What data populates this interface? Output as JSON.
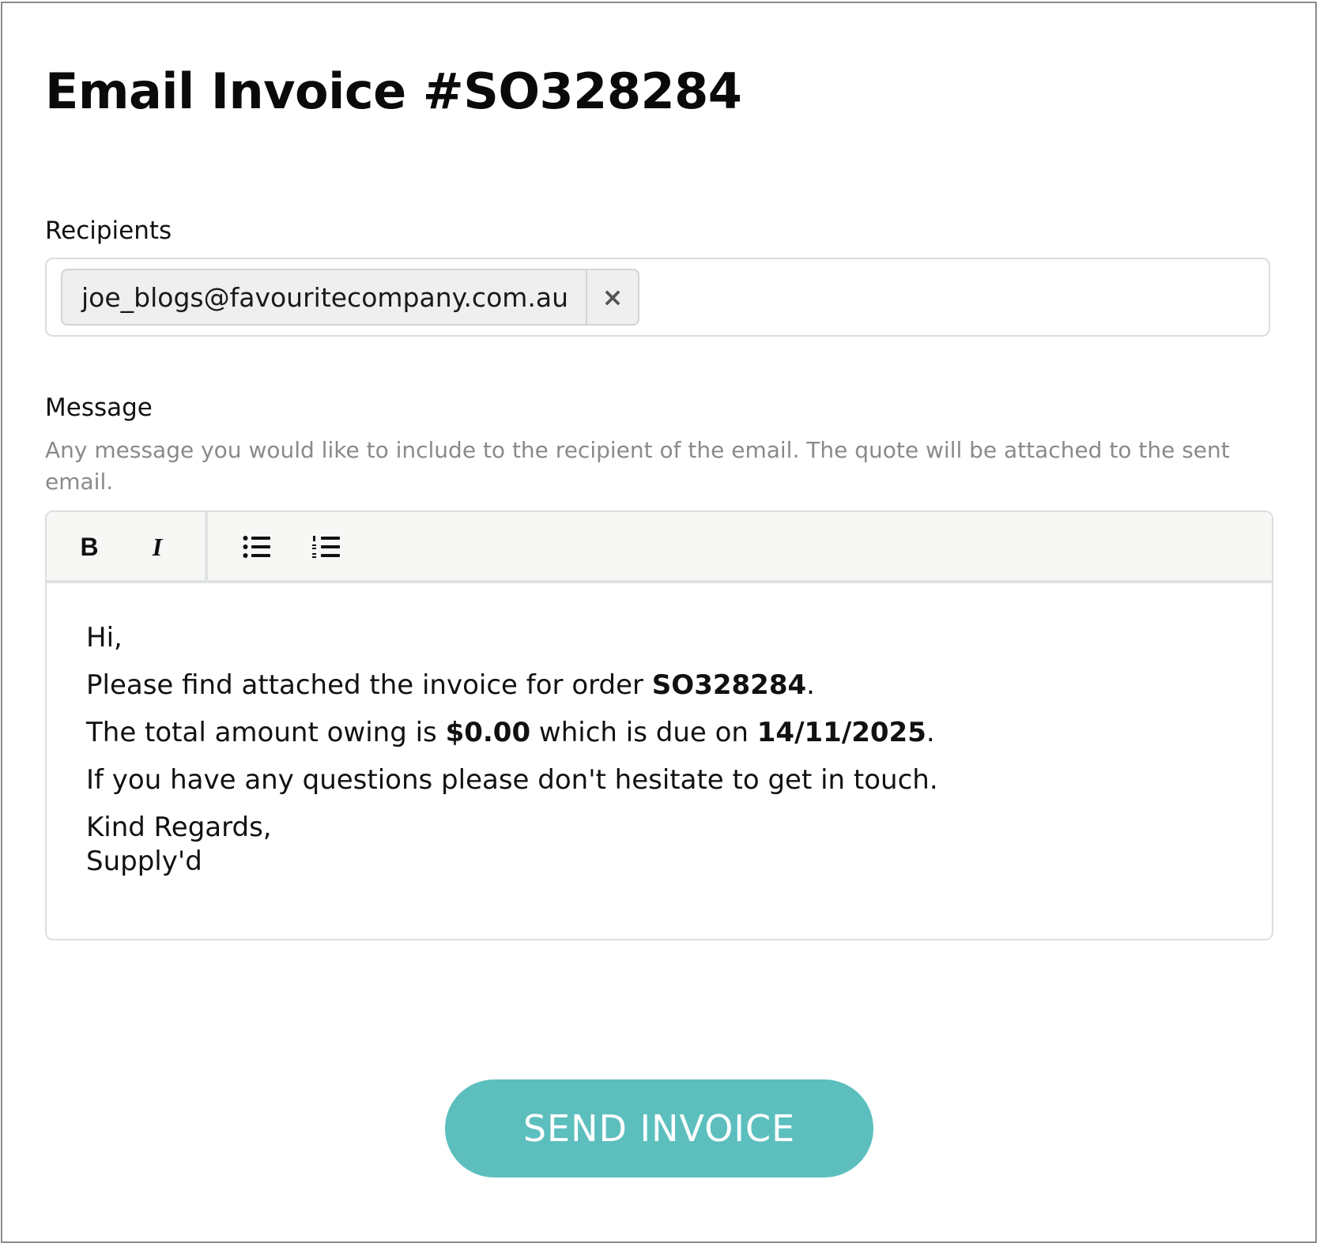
{
  "page": {
    "title": "Email Invoice #SO328284"
  },
  "recipients": {
    "label": "Recipients",
    "chips": [
      {
        "email": "joe_blogs@favouritecompany.com.au",
        "remove_icon": "close-icon",
        "remove_glyph": "×"
      }
    ]
  },
  "message": {
    "label": "Message",
    "help_text": "Any message you would like to include to the recipient of the email. The quote will be attached to the sent email.",
    "toolbar": {
      "bold_label": "B",
      "italic_label": "I",
      "bullet_list_icon": "bulleted-list-icon",
      "numbered_list_icon": "numbered-list-icon"
    },
    "body": {
      "greeting": "Hi,",
      "line1_prefix": "Please find attached the invoice for order ",
      "order_number": "SO328284",
      "line1_suffix": ".",
      "line2_prefix": "The total amount owing is ",
      "amount": "$0.00",
      "line2_middle": " which is due on ",
      "due_date": "14/11/2025",
      "line2_suffix": ".",
      "line3": "If you have any questions please don't hesitate to get in touch.",
      "signoff": "Kind Regards,",
      "signature": "Supply'd"
    }
  },
  "actions": {
    "send_label": "SEND INVOICE"
  },
  "colors": {
    "accent": "#5cbfbe",
    "chip_background": "#efefef",
    "help_text": "#8a8a8a",
    "toolbar_background": "#f7f7f5"
  }
}
